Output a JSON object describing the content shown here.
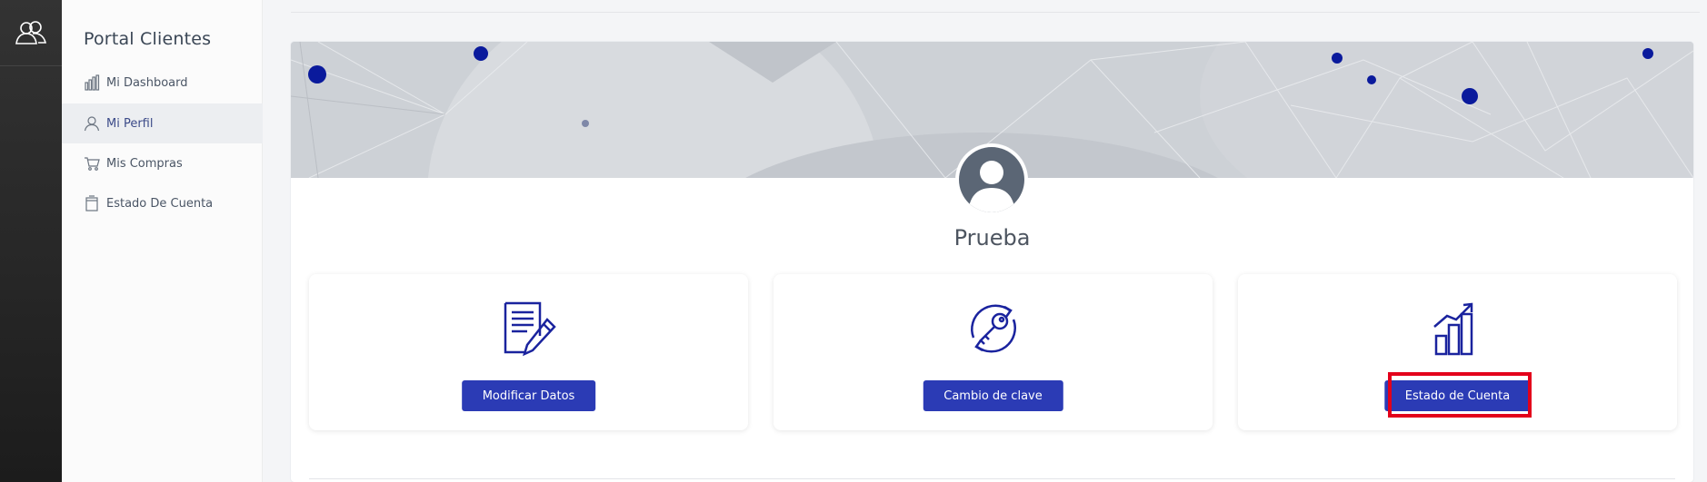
{
  "sidebar": {
    "title": "Portal Clientes",
    "items": [
      {
        "label": "Mi Dashboard",
        "icon": "bar-chart-icon",
        "active": false
      },
      {
        "label": "Mi Perfil",
        "icon": "user-icon",
        "active": true
      },
      {
        "label": "Mis Compras",
        "icon": "cart-icon",
        "active": false
      },
      {
        "label": "Estado De Cuenta",
        "icon": "document-icon",
        "active": false
      }
    ]
  },
  "profile": {
    "name": "Prueba"
  },
  "actions": [
    {
      "label": "Modificar Datos",
      "icon": "edit-document-icon"
    },
    {
      "label": "Cambio de clave",
      "icon": "key-refresh-icon"
    },
    {
      "label": "Estado de Cuenta",
      "icon": "growth-chart-icon",
      "highlighted": true
    }
  ],
  "colors": {
    "accent": "#2b3bb5",
    "icon_blue": "#1a239e",
    "highlight": "#e3001b",
    "banner_dot": "#0a1a9c"
  }
}
